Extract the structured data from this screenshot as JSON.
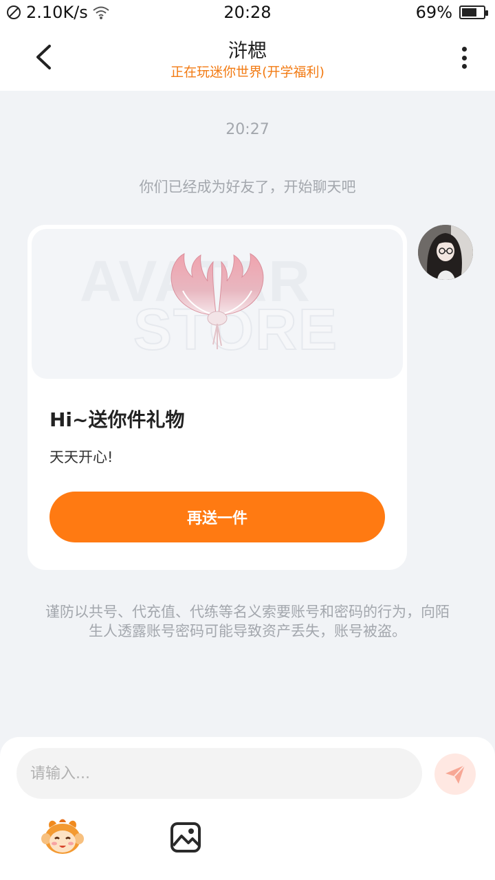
{
  "status_bar": {
    "network_speed": "2.10K/s",
    "time": "20:28",
    "battery_percent": "69%",
    "battery_level": 0.69
  },
  "header": {
    "title": "浒楒",
    "subtitle": "正在玩迷你世界(开学福利)"
  },
  "chat": {
    "timestamp": "20:27",
    "system_message": "你们已经成为好友了，开始聊天吧",
    "gift_card": {
      "watermark_line1": "AVATAR",
      "watermark_line2": "STORE",
      "title": "Hi~送你件礼物",
      "description": "天天开心!",
      "button_label": "再送一件"
    },
    "warning": "谨防以共号、代充值、代练等名义索要账号和密码的行为，向陌生人透露账号密码可能导致资产丢失，账号被盗。"
  },
  "input_bar": {
    "placeholder": "请输入..."
  },
  "colors": {
    "accent": "#ff7a12",
    "subtitle": "#f27a12",
    "background": "#f1f3f6",
    "muted_text": "#a3a7ad"
  },
  "icons": [
    "no-sim-icon",
    "wifi-icon",
    "battery-icon",
    "back-arrow-icon",
    "more-vertical-icon",
    "wings-gift-icon",
    "send-icon",
    "emoji-face-icon",
    "image-icon"
  ]
}
